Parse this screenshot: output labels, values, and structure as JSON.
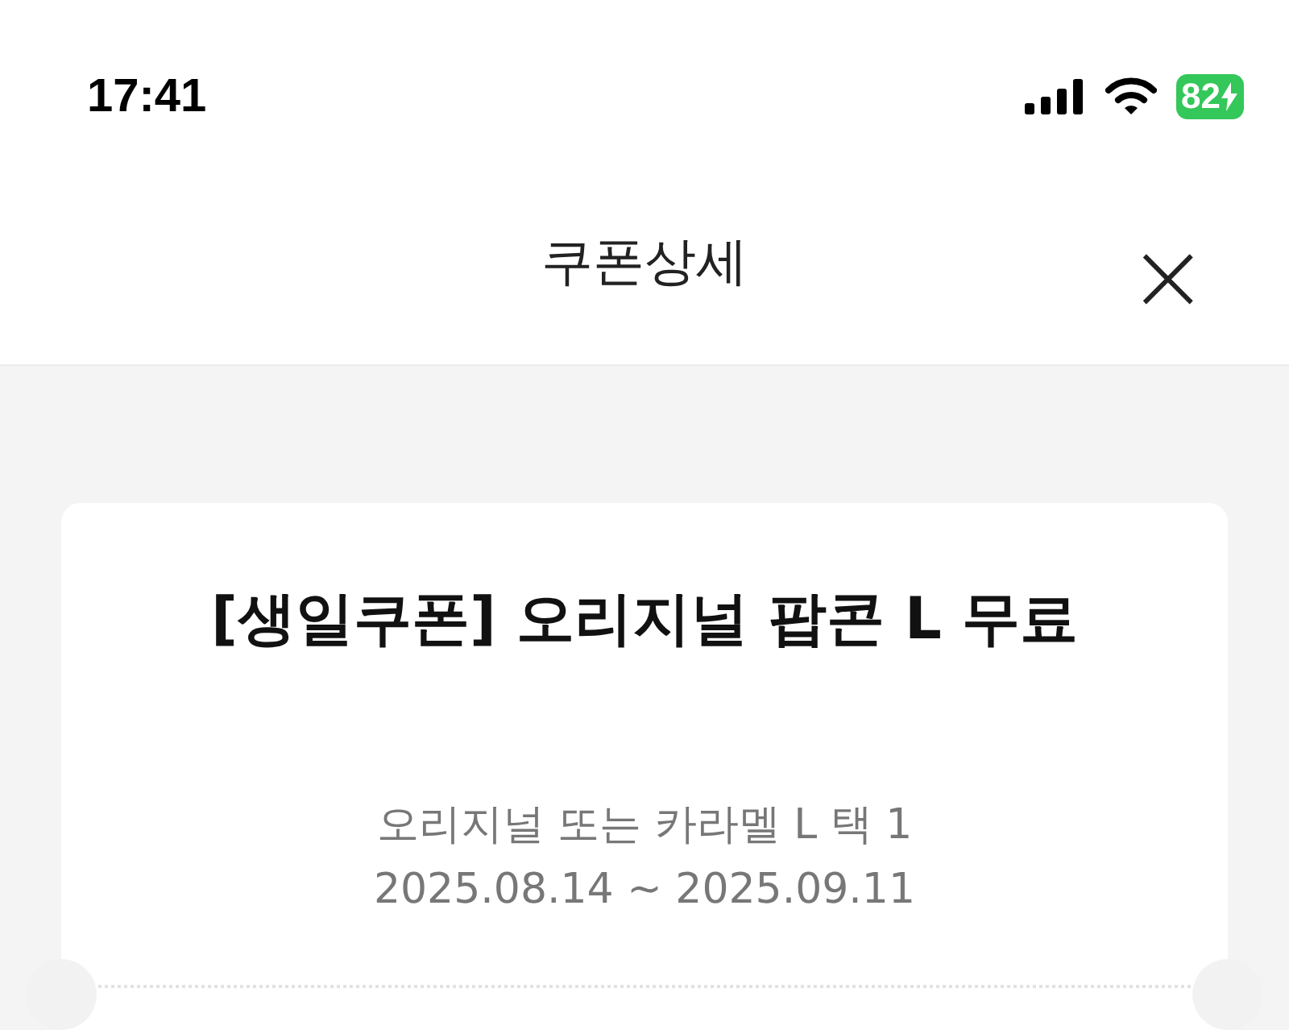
{
  "status_bar": {
    "time": "17:41",
    "battery": "82"
  },
  "header": {
    "title": "쿠폰상세",
    "close": "×"
  },
  "coupon": {
    "title": "[생일쿠폰] 오리지널 팝콘 L 무료",
    "description": "오리지널 또는 카라멜 L 택 1",
    "period": "2025.08.14 ~ 2025.09.11"
  }
}
